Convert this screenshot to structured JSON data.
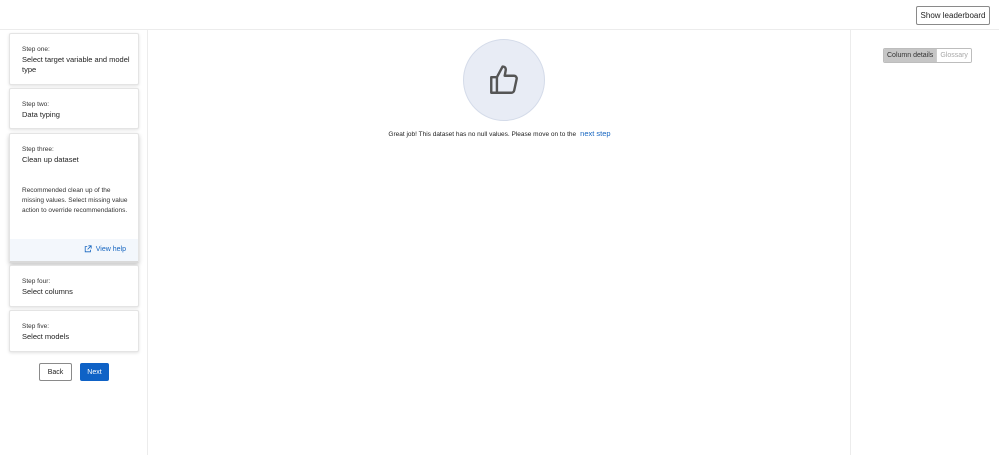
{
  "header": {
    "leaderboard_label": "Show leaderboard"
  },
  "steps": [
    {
      "num": "Step one:",
      "title": "Select target variable and model type"
    },
    {
      "num": "Step two:",
      "title": "Data typing"
    },
    {
      "num": "Step three:",
      "title": "Clean up dataset",
      "description": "Recommended clean up of the missing values. Select missing value action to override recommendations.",
      "help_label": "View help"
    },
    {
      "num": "Step four:",
      "title": "Select columns"
    },
    {
      "num": "Step five:",
      "title": "Select models"
    }
  ],
  "nav": {
    "back_label": "Back",
    "next_label": "Next"
  },
  "main": {
    "icon": "thumbs-up-icon",
    "message": "Great job! This dataset has no null values. Please move on to the",
    "next_step_link": "next step"
  },
  "right_panel": {
    "tabs": [
      "Column details",
      "Glossary"
    ],
    "selected_tab": "Column details"
  },
  "colors": {
    "accent": "#0f62c6",
    "link": "#1565c0",
    "icon_circle": "#e8ecf5"
  }
}
